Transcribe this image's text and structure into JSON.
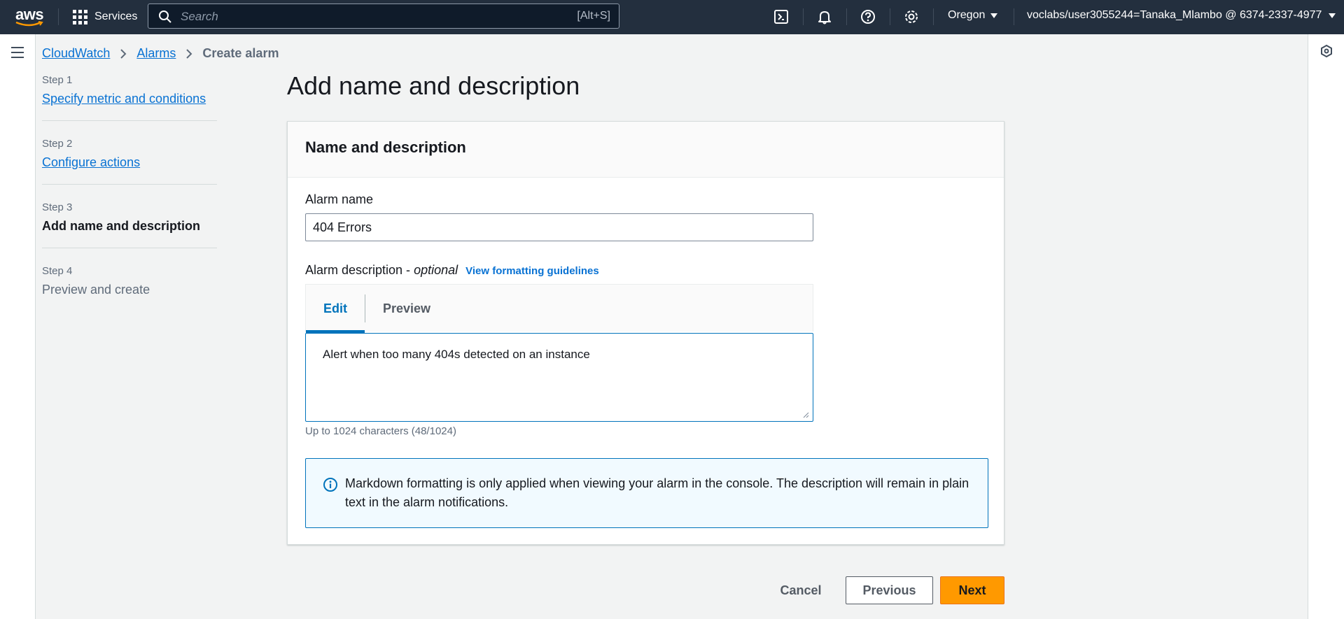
{
  "topnav": {
    "logo": "aws",
    "services_label": "Services",
    "search_placeholder": "Search",
    "search_shortcut": "[Alt+S]",
    "region": "Oregon",
    "account": "voclabs/user3055244=Tanaka_Mlambo @ 6374-2337-4977",
    "icons": [
      "cloudshell-icon",
      "bell-icon",
      "help-icon",
      "gear-icon"
    ]
  },
  "breadcrumb": {
    "items": [
      "CloudWatch",
      "Alarms"
    ],
    "current": "Create alarm"
  },
  "steps": [
    {
      "num": "Step 1",
      "label": "Specify metric and conditions",
      "state": "link"
    },
    {
      "num": "Step 2",
      "label": "Configure actions",
      "state": "link"
    },
    {
      "num": "Step 3",
      "label": "Add name and description",
      "state": "active"
    },
    {
      "num": "Step 4",
      "label": "Preview and create",
      "state": "disabled"
    }
  ],
  "main": {
    "title": "Add name and description",
    "panel_title": "Name and description",
    "alarm_name_label": "Alarm name",
    "alarm_name_value": "404 Errors",
    "desc_label": "Alarm description -",
    "desc_optional": "optional",
    "desc_link": "View formatting guidelines",
    "tabs": [
      "Edit",
      "Preview"
    ],
    "desc_value": "Alert when too many 404s detected on an instance",
    "char_hint": "Up to 1024 characters (48/1024)",
    "info_text": "Markdown formatting is only applied when viewing your alarm in the console. The description will remain in plain text in the alarm notifications."
  },
  "actions": {
    "cancel": "Cancel",
    "previous": "Previous",
    "next": "Next"
  },
  "colors": {
    "nav_bg": "#232f3e",
    "link": "#0972d3",
    "primary": "#ff9900"
  }
}
